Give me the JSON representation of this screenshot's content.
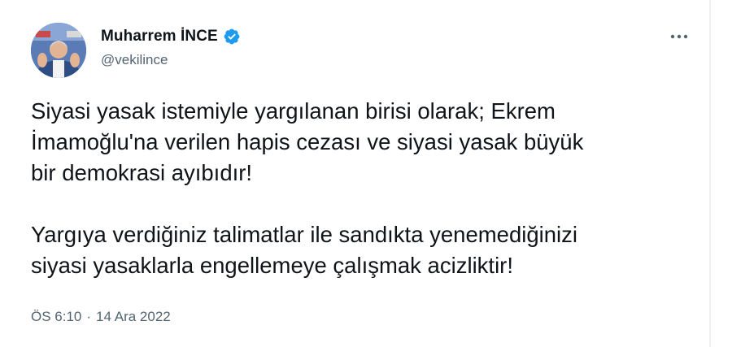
{
  "tweet": {
    "author": {
      "display_name": "Muharrem İNCE",
      "handle": "@vekilince",
      "verified": true,
      "avatar_icon": "profile-photo"
    },
    "text_paragraphs": [
      {
        "lines": [
          "Siyasi yasak istemiyle yargılanan birisi olarak; Ekrem",
          "İmamoğlu'na verilen hapis cezası ve siyasi yasak büyük",
          "bir demokrasi ayıbıdır!"
        ]
      },
      {
        "lines": [
          "Yargıya verdiğiniz talimatlar ile sandıkta yenemediğinizi",
          "siyasi yasaklarla engellemeye çalışmak acizliktir!"
        ]
      }
    ],
    "time": "ÖS 6:10",
    "separator": "·",
    "date": "14 Ara 2022",
    "more_icon": "more-horizontal-icon",
    "colors": {
      "text": "#0f1419",
      "secondary": "#536471",
      "verified": "#1d9bf0"
    }
  }
}
